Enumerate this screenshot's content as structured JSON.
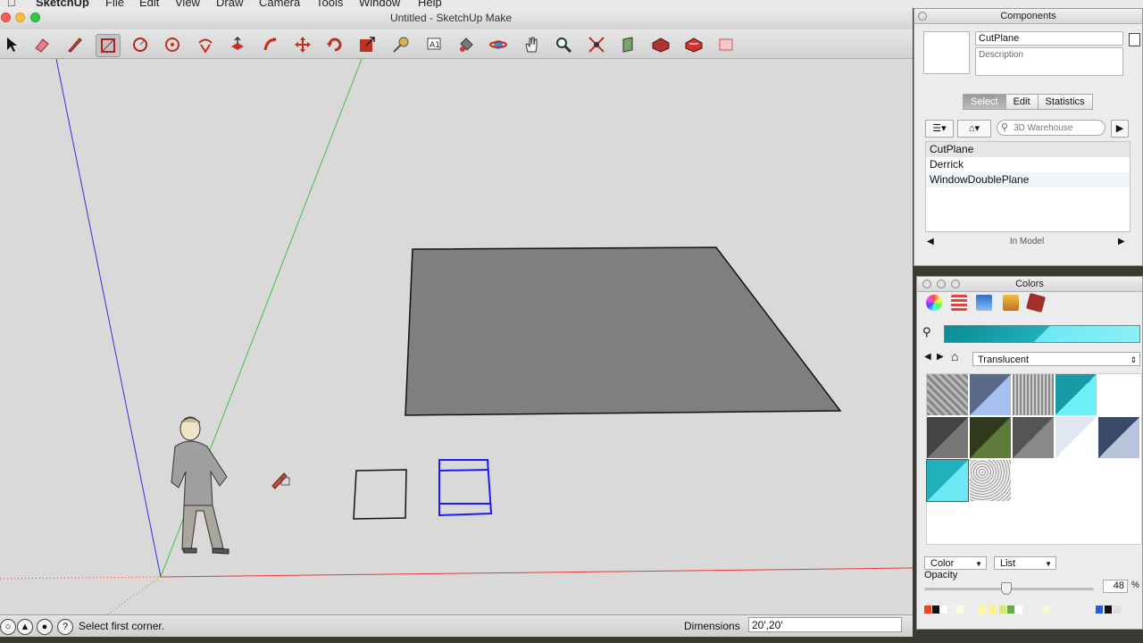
{
  "menubar": {
    "app": "SketchUp",
    "items": [
      "File",
      "Edit",
      "View",
      "Draw",
      "Camera",
      "Tools",
      "Window",
      "Help"
    ]
  },
  "window": {
    "title": "Untitled - SketchUp Make"
  },
  "toolbar": {
    "tools": [
      "select",
      "eraser",
      "pencil-line",
      "rectangle",
      "circle",
      "arc",
      "polygon",
      "push-pull",
      "follow-me",
      "move",
      "rotate",
      "scale",
      "tape-measure",
      "text",
      "orbit",
      "pan",
      "hand",
      "zoom",
      "zoom-extents",
      "section",
      "warehouse",
      "extension",
      "components"
    ],
    "selected": "rectangle"
  },
  "statusbar": {
    "message": "Select first corner.",
    "dimensions_label": "Dimensions",
    "dimensions_value": "20',20'"
  },
  "components": {
    "title": "Components",
    "name_value": "CutPlane",
    "description_placeholder": "Description",
    "tabs": [
      "Select",
      "Edit",
      "Statistics"
    ],
    "active_tab": "Select",
    "search_placeholder": "3D Warehouse",
    "items": [
      "CutPlane",
      "Derrick",
      "WindowDoublePlane"
    ],
    "selected_item": "CutPlane",
    "footer": "In Model"
  },
  "colors": {
    "title": "Colors",
    "material_set": "Translucent",
    "current_color": "#3ec8d4",
    "mode_select": "Color",
    "view_select": "List",
    "opacity_label": "Opacity",
    "opacity_value": "48",
    "opacity_unit": "%",
    "opacity_fraction": 0.48
  },
  "scene": {
    "axis_colors": {
      "red": "#e8393a",
      "green": "#3fc23f",
      "blue": "#3030e0"
    },
    "large_face_color": "#7f7f7f",
    "selected_color": "#1a1aff"
  }
}
